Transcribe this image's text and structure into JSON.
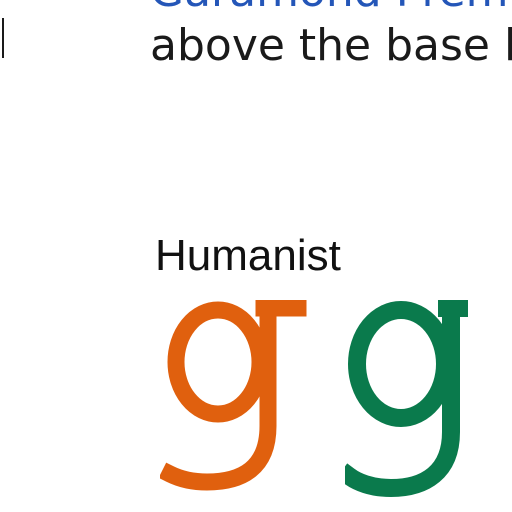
{
  "text": {
    "top_line": "Garamond Prem",
    "second_line": "above the base l",
    "section_title": "Humanist",
    "glyph_left": "g",
    "glyph_right": "g"
  },
  "colors": {
    "top_line": "#2456b8",
    "glyph_left": "#e0600e",
    "glyph_right": "#0a7a4c",
    "text": "#1a1a1a"
  }
}
